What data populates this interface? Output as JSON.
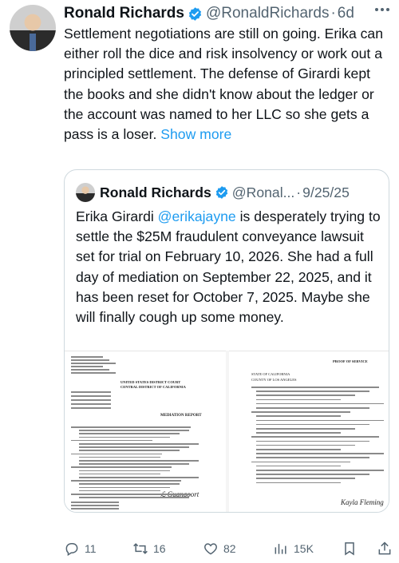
{
  "post": {
    "author_name": "Ronald Richards",
    "handle": "@RonaldRichards",
    "separator": "·",
    "age": "6d",
    "text": "Settlement negotiations are still on going. Erika can either roll the dice and risk insolvency or work out a principled settlement.  The defense of Girardi kept the books and she didn't know about the ledger or the account was named to her LLC so she gets a pass is a loser. ",
    "show_more": "Show more"
  },
  "quote": {
    "author_name": "Ronald Richards",
    "handle": "@Ronal...",
    "separator": "·",
    "date": "9/25/25",
    "text_before": "Erika Girardi ",
    "mention": "@erikajayne",
    "text_after": " is desperately trying to settle the $25M fraudulent conveyance lawsuit set for trial on February 10, 2026.  She had a full day of mediation on September 22, 2025, and it has been reset for October 7, 2025.  Maybe she will finally cough up some money.",
    "doc_left": {
      "court": "UNITED STATES DISTRICT COURT",
      "district": "CENTRAL DISTRICT OF CALIFORNIA",
      "report": "MEDIATION REPORT"
    },
    "doc_right": {
      "heading": "PROOF OF SERVICE",
      "state": "STATE OF CALIFORNIA",
      "county": "COUNTY OF LOS ANGELES",
      "signature": "Kayla Fleming"
    }
  },
  "actions": {
    "replies": "11",
    "reposts": "16",
    "likes": "82",
    "views": "15K"
  },
  "colors": {
    "accent": "#1d9bf0",
    "text": "#0f1419",
    "muted": "#536471",
    "border": "#cfd9de"
  },
  "icons": [
    "verified-badge-icon",
    "more-icon",
    "reply-icon",
    "retweet-icon",
    "heart-icon",
    "views-icon",
    "bookmark-icon",
    "share-icon"
  ]
}
